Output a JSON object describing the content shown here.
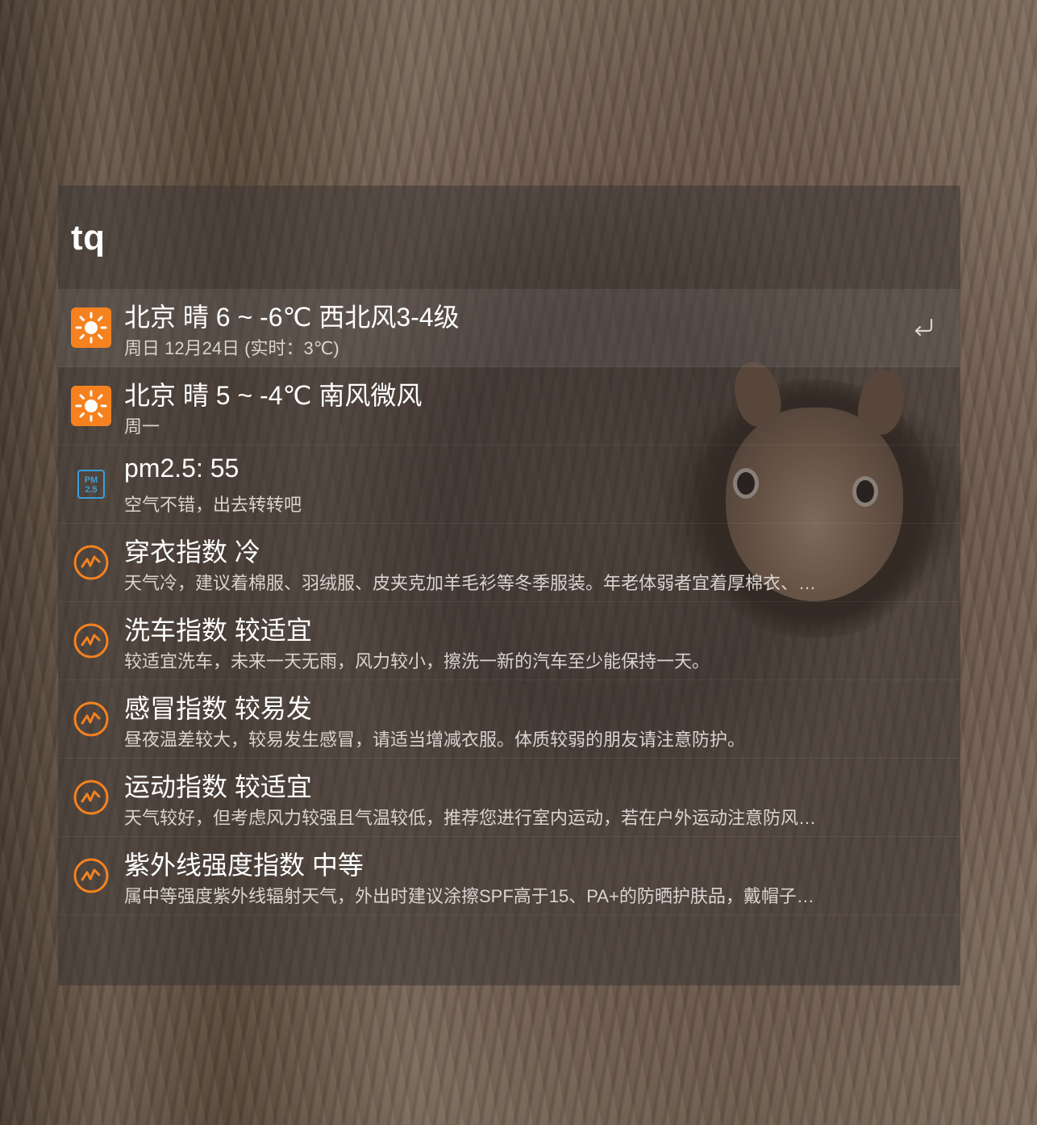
{
  "query": "tq",
  "results": [
    {
      "title": "北京 晴 6 ~ -6℃ 西北风3-4级",
      "subtitle": "周日 12月24日 (实时：3℃)",
      "icon": "sun-icon"
    },
    {
      "title": "北京 晴 5 ~ -4℃ 南风微风",
      "subtitle": "周一",
      "icon": "sun-icon"
    },
    {
      "title": "pm2.5: 55",
      "subtitle": "空气不错，出去转转吧",
      "icon": "pm25-icon"
    },
    {
      "title": "穿衣指数 冷",
      "subtitle": "天气冷，建议着棉服、羽绒服、皮夹克加羊毛衫等冬季服装。年老体弱者宜着厚棉衣、…",
      "icon": "index-icon"
    },
    {
      "title": "洗车指数 较适宜",
      "subtitle": "较适宜洗车，未来一天无雨，风力较小，擦洗一新的汽车至少能保持一天。",
      "icon": "index-icon"
    },
    {
      "title": "感冒指数 较易发",
      "subtitle": "昼夜温差较大，较易发生感冒，请适当增减衣服。体质较弱的朋友请注意防护。",
      "icon": "index-icon"
    },
    {
      "title": "运动指数 较适宜",
      "subtitle": "天气较好，但考虑风力较强且气温较低，推荐您进行室内运动，若在户外运动注意防风…",
      "icon": "index-icon"
    },
    {
      "title": "紫外线强度指数 中等",
      "subtitle": "属中等强度紫外线辐射天气，外出时建议涂擦SPF高于15、PA+的防晒护肤品，戴帽子…",
      "icon": "index-icon"
    }
  ],
  "pm_icon_text": [
    "PM",
    "2.5"
  ],
  "colors": {
    "accent": "#f5821f",
    "pm_blue": "#3aa0d8"
  }
}
